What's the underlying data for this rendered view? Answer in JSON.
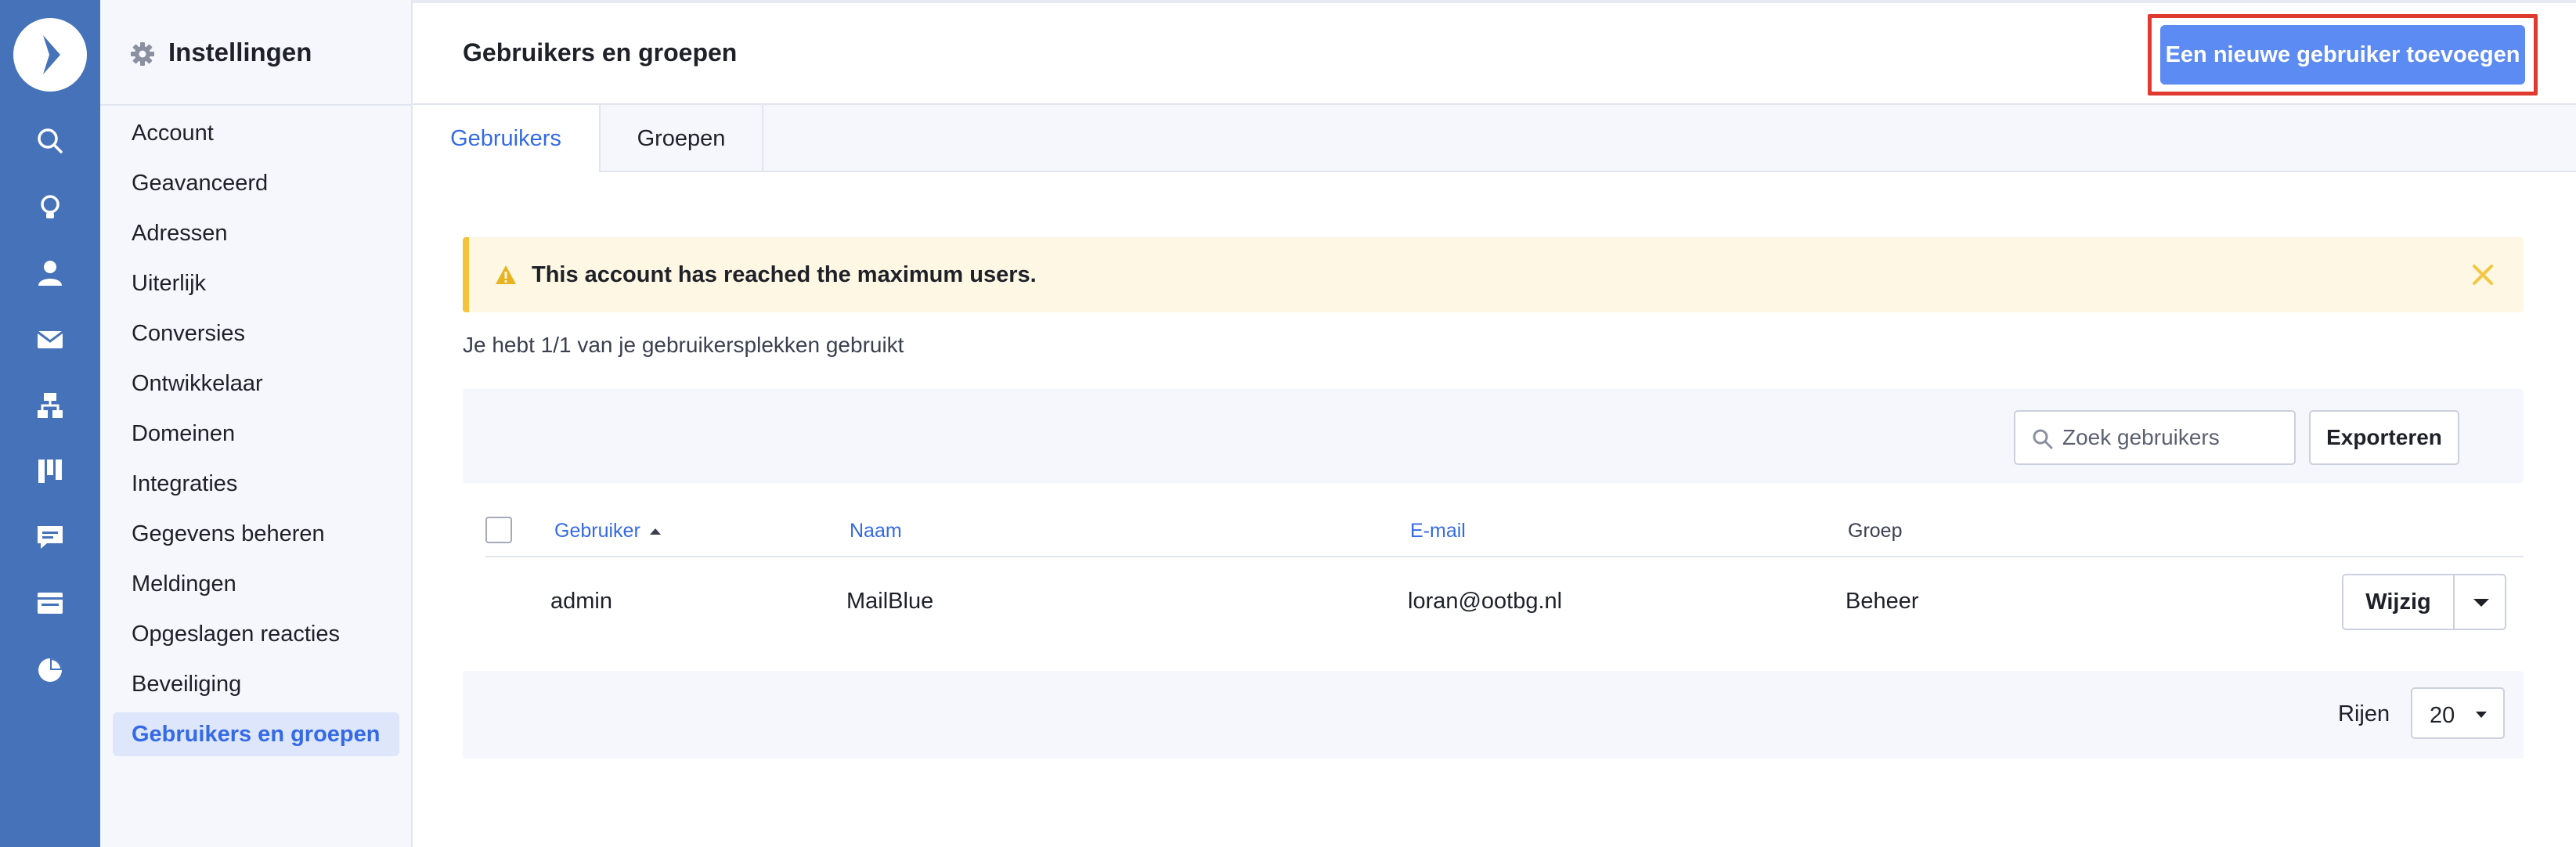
{
  "rail": {
    "icons": [
      "logo-icon",
      "search-icon",
      "lightbulb-icon",
      "person-icon",
      "envelope-icon",
      "sitemap-icon",
      "kanban-icon",
      "chat-icon",
      "browser-icon",
      "pie-chart-icon"
    ]
  },
  "sidebar": {
    "title": "Instellingen",
    "items": [
      {
        "label": "Account"
      },
      {
        "label": "Geavanceerd"
      },
      {
        "label": "Adressen"
      },
      {
        "label": "Uiterlijk"
      },
      {
        "label": "Conversies"
      },
      {
        "label": "Ontwikkelaar"
      },
      {
        "label": "Domeinen"
      },
      {
        "label": "Integraties"
      },
      {
        "label": "Gegevens beheren"
      },
      {
        "label": "Meldingen"
      },
      {
        "label": "Opgeslagen reacties"
      },
      {
        "label": "Beveiliging"
      },
      {
        "label": "Gebruikers en groepen",
        "active": true
      }
    ]
  },
  "header": {
    "title": "Gebruikers en groepen",
    "new_user_button": "Een nieuwe gebruiker toevoegen"
  },
  "tabs": [
    {
      "label": "Gebruikers",
      "active": true
    },
    {
      "label": "Groepen"
    }
  ],
  "alert": {
    "text": "This account has reached the maximum users."
  },
  "usage_text": "Je hebt 1/1 van je gebruikersplekken gebruikt",
  "toolbar": {
    "search_placeholder": "Zoek gebruikers",
    "export_label": "Exporteren"
  },
  "table": {
    "columns": [
      "Gebruiker",
      "Naam",
      "E-mail",
      "Groep"
    ],
    "rows": [
      {
        "user": "admin",
        "name": "MailBlue",
        "email": "loran@ootbg.nl",
        "group": "Beheer",
        "action": "Wijzig"
      }
    ]
  },
  "pagination": {
    "rows_label": "Rijen",
    "rows_value": "20"
  },
  "colors": {
    "rail": "#4672b9",
    "accent": "#356ae6",
    "primary_button": "#5d8bf4",
    "highlight_outline": "#e03a2f",
    "warning": "#f5c33b"
  }
}
